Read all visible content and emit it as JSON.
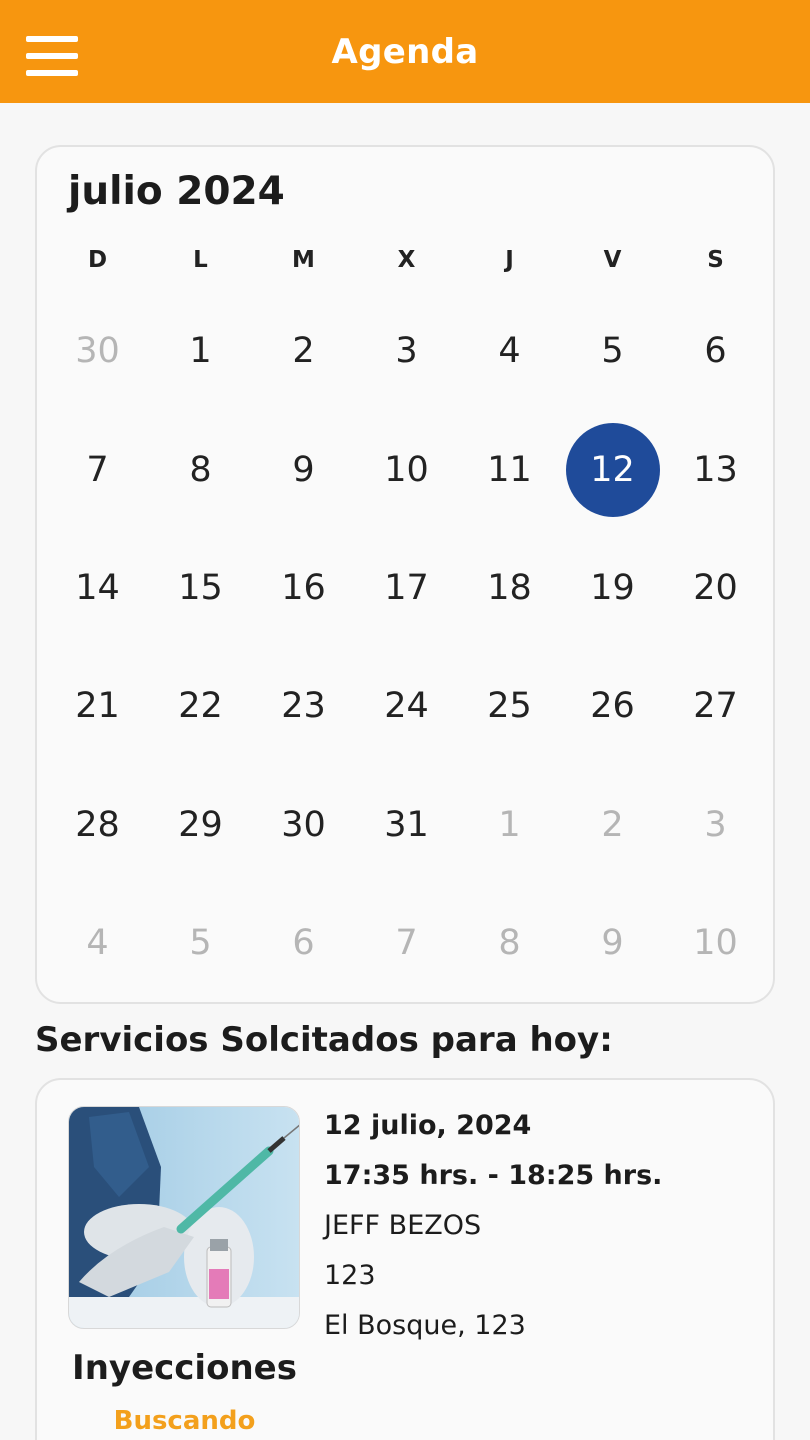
{
  "appbar": {
    "title": "Agenda",
    "menu_icon": "hamburger-menu-icon",
    "color": "#f7960f"
  },
  "calendar": {
    "month_label": "julio 2024",
    "weekdays": [
      "D",
      "L",
      "M",
      "X",
      "J",
      "V",
      "S"
    ],
    "selected_color": "#1f4b9a",
    "weeks": [
      [
        {
          "d": "30",
          "muted": true
        },
        {
          "d": "1"
        },
        {
          "d": "2"
        },
        {
          "d": "3"
        },
        {
          "d": "4"
        },
        {
          "d": "5"
        },
        {
          "d": "6"
        }
      ],
      [
        {
          "d": "7"
        },
        {
          "d": "8"
        },
        {
          "d": "9"
        },
        {
          "d": "10"
        },
        {
          "d": "11"
        },
        {
          "d": "12",
          "selected": true
        },
        {
          "d": "13"
        }
      ],
      [
        {
          "d": "14"
        },
        {
          "d": "15"
        },
        {
          "d": "16"
        },
        {
          "d": "17"
        },
        {
          "d": "18"
        },
        {
          "d": "19"
        },
        {
          "d": "20"
        }
      ],
      [
        {
          "d": "21"
        },
        {
          "d": "22"
        },
        {
          "d": "23"
        },
        {
          "d": "24"
        },
        {
          "d": "25"
        },
        {
          "d": "26"
        },
        {
          "d": "27"
        }
      ],
      [
        {
          "d": "28"
        },
        {
          "d": "29"
        },
        {
          "d": "30"
        },
        {
          "d": "31"
        },
        {
          "d": "1",
          "muted": true
        },
        {
          "d": "2",
          "muted": true
        },
        {
          "d": "3",
          "muted": true
        }
      ],
      [
        {
          "d": "4",
          "muted": true
        },
        {
          "d": "5",
          "muted": true
        },
        {
          "d": "6",
          "muted": true
        },
        {
          "d": "7",
          "muted": true
        },
        {
          "d": "8",
          "muted": true
        },
        {
          "d": "9",
          "muted": true
        },
        {
          "d": "10",
          "muted": true
        }
      ]
    ]
  },
  "services": {
    "section_title": "Servicios Solcitados para hoy:",
    "items": [
      {
        "name": "Inyecciones",
        "status": "Buscando",
        "status_color": "#f3a01c",
        "image_icon": "injection-photo",
        "date": "12 julio, 2024",
        "time": "17:35 hrs. - 18:25 hrs.",
        "client": "JEFF BEZOS",
        "number": "123",
        "address": "El Bosque, 123"
      }
    ]
  }
}
